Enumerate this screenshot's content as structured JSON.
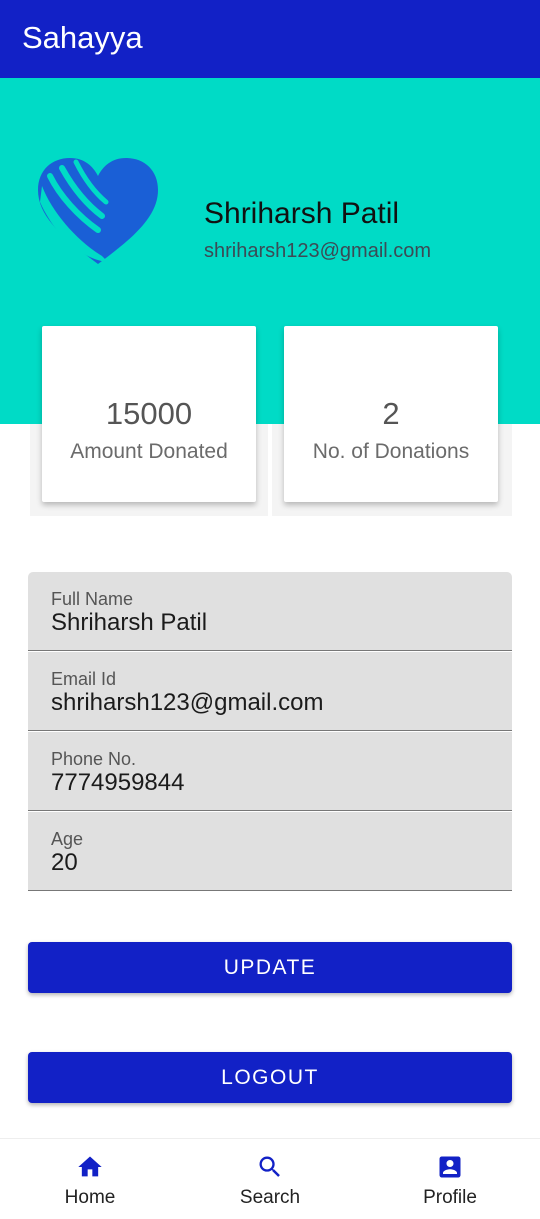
{
  "app": {
    "title": "Sahayya"
  },
  "profile": {
    "name": "Shriharsh Patil",
    "email": "shriharsh123@gmail.com"
  },
  "stats": [
    {
      "value": "15000",
      "label": "Amount Donated"
    },
    {
      "value": "2",
      "label": "No. of Donations"
    }
  ],
  "form": {
    "fields": [
      {
        "label": "Full Name",
        "value": "Shriharsh Patil"
      },
      {
        "label": "Email Id",
        "value": "shriharsh123@gmail.com"
      },
      {
        "label": "Phone No.",
        "value": "7774959844"
      },
      {
        "label": "Age",
        "value": "20"
      }
    ]
  },
  "buttons": {
    "update": "UPDATE",
    "logout": "LOGOUT"
  },
  "nav": [
    {
      "label": "Home",
      "icon": "home-icon"
    },
    {
      "label": "Search",
      "icon": "search-icon"
    },
    {
      "label": "Profile",
      "icon": "profile-icon"
    }
  ],
  "colors": {
    "primary": "#1221c6",
    "accent": "#00dbc6",
    "logo": "#1a5fd6"
  }
}
